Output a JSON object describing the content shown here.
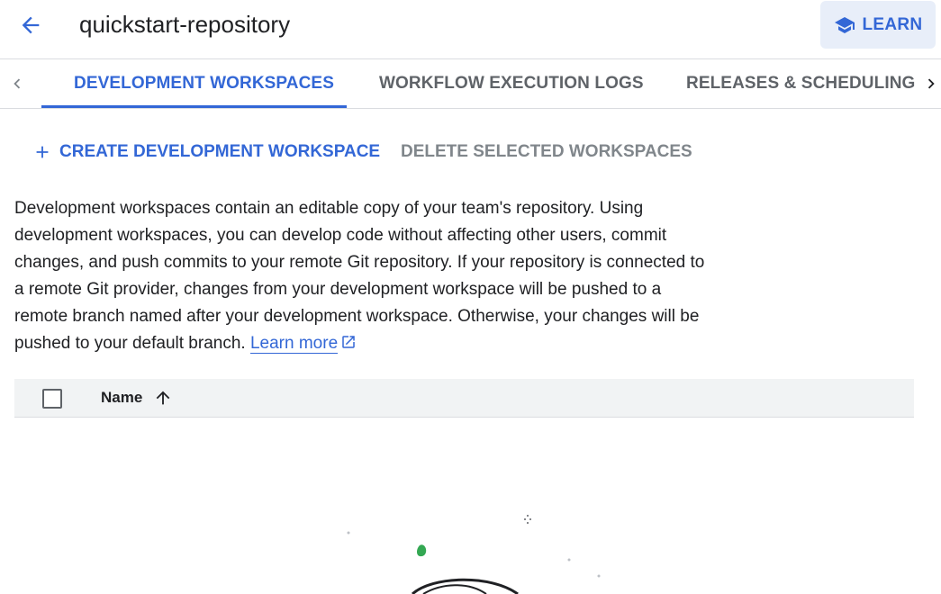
{
  "header": {
    "title": "quickstart-repository",
    "back_icon": "arrow-back-icon",
    "learn_label": "LEARN",
    "learn_icon": "school-icon"
  },
  "tabs": [
    {
      "label": "DEVELOPMENT WORKSPACES",
      "active": true
    },
    {
      "label": "WORKFLOW EXECUTION LOGS",
      "active": false
    },
    {
      "label": "RELEASES & SCHEDULING",
      "active": false
    }
  ],
  "actions": {
    "create_label": "CREATE DEVELOPMENT WORKSPACE",
    "delete_label": "DELETE SELECTED WORKSPACES"
  },
  "description": {
    "text": "Development workspaces contain an editable copy of your team's repository. Using development workspaces, you can develop code without affecting other users, commit changes, and push commits to your remote Git repository. If your repository is connected to a remote Git provider, changes from your development workspace will be pushed to a remote branch named after your development workspace. Otherwise, your changes will be pushed to your default branch.",
    "link_label": "Learn more"
  },
  "table": {
    "columns": [
      {
        "label": "Name",
        "sort": "ascending"
      }
    ]
  },
  "colors": {
    "accent": "#3367d6",
    "learn_bg": "#e8eef9",
    "header_bg": "#f1f3f4",
    "muted": "#80868b",
    "illustration_green": "#34a853"
  }
}
